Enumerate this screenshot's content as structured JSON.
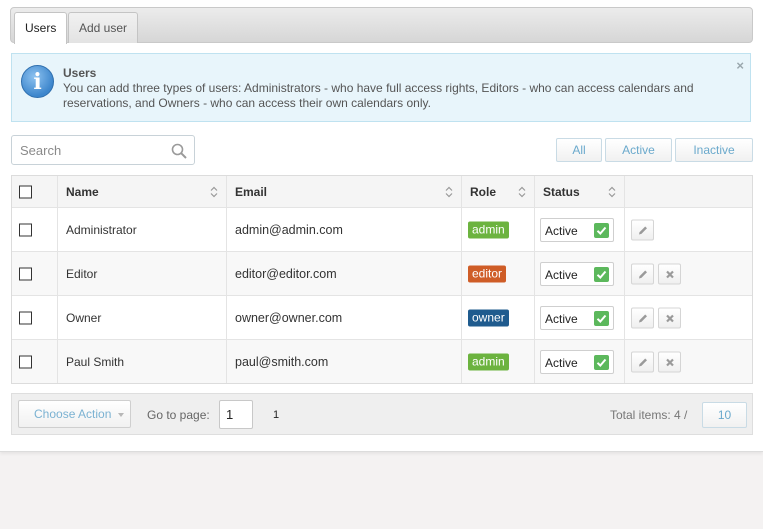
{
  "tabs": [
    {
      "label": "Users",
      "active": true
    },
    {
      "label": "Add user",
      "active": false
    }
  ],
  "info": {
    "title": "Users",
    "text": "You can add three types of users: Administrators - who have full access rights, Editors - who can access calendars and reservations, and Owners - who can access their own calendars only.",
    "close": "×"
  },
  "search": {
    "placeholder": "Search",
    "value": ""
  },
  "filters": [
    "All",
    "Active",
    "Inactive"
  ],
  "table": {
    "columns": [
      "Name",
      "Email",
      "Role",
      "Status"
    ],
    "rows": [
      {
        "name": "Administrator",
        "email": "admin@admin.com",
        "role": "admin",
        "status": "Active",
        "deletable": false
      },
      {
        "name": "Editor",
        "email": "editor@editor.com",
        "role": "editor",
        "status": "Active",
        "deletable": true
      },
      {
        "name": "Owner",
        "email": "owner@owner.com",
        "role": "owner",
        "status": "Active",
        "deletable": true
      },
      {
        "name": "Paul Smith",
        "email": "paul@smith.com",
        "role": "admin",
        "status": "Active",
        "deletable": true
      }
    ]
  },
  "role_colors": {
    "admin": "#6cb33f",
    "editor": "#cf5d27",
    "owner": "#1f5b8e"
  },
  "footer": {
    "choose_action": "Choose Action",
    "goto_label": "Go to page:",
    "goto_value": "1",
    "page": "1",
    "total": "Total items: 4 /",
    "per_page": "10"
  }
}
